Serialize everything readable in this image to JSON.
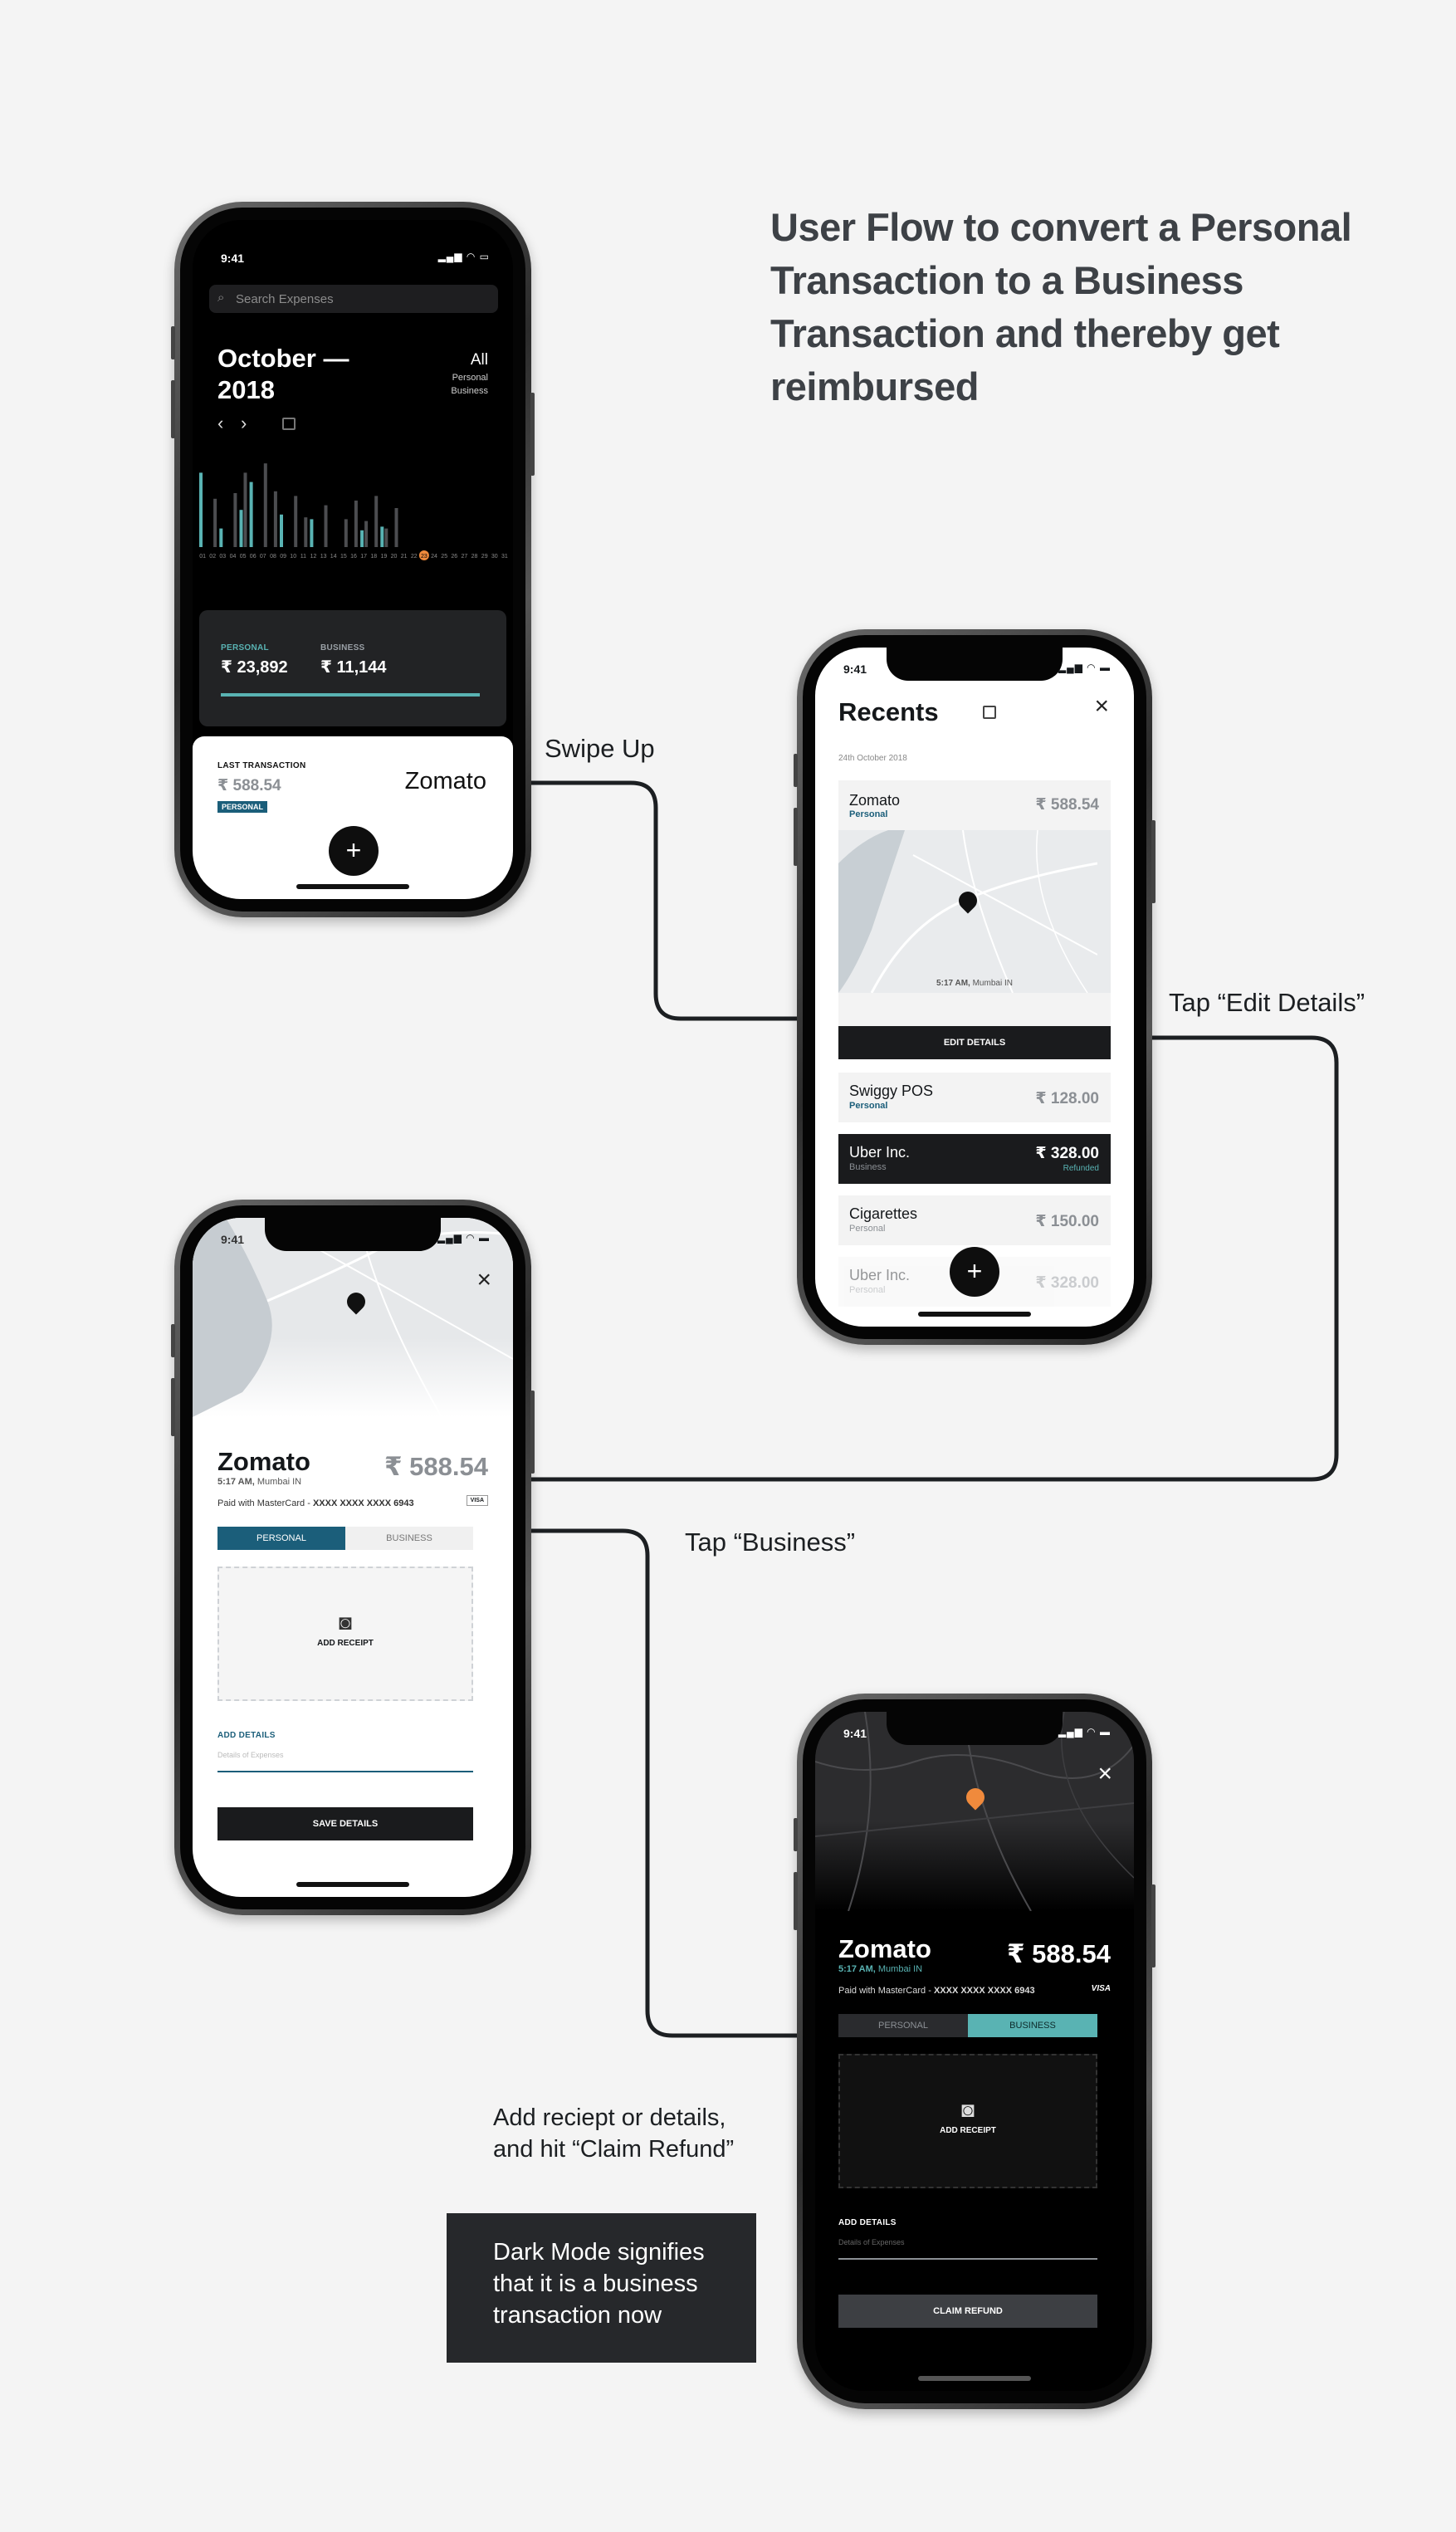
{
  "heading": "User Flow to convert a Personal Transaction to a Business Transaction and thereby get reimbursed",
  "flow_labels": {
    "swipe_up": "Swipe Up",
    "tap_edit": "Tap “Edit Details”",
    "tap_business": "Tap “Business”",
    "add_receipt_note": "Add reciept or details,\nand hit “Claim Refund”",
    "dark_mode_note": "Dark Mode signifies that it is a business transaction now"
  },
  "colors": {
    "teal": "#59b3b3",
    "navy": "#1b5e7a",
    "orange": "#f08a3c"
  },
  "status_bar": {
    "time": "9:41"
  },
  "screen1": {
    "search_placeholder": "Search Expenses",
    "month": "October",
    "year": "2018",
    "filter_all": "All",
    "filter_personal": "Personal",
    "filter_business": "Business",
    "chart_data": {
      "type": "bar",
      "categories": [
        "01",
        "02",
        "03",
        "04",
        "05",
        "06",
        "07",
        "08",
        "09",
        "10",
        "11",
        "12",
        "13",
        "14",
        "15",
        "16",
        "17",
        "18",
        "19",
        "20",
        "21",
        "22",
        "23",
        "24",
        "25",
        "26",
        "27",
        "28",
        "29",
        "30",
        "31"
      ],
      "series": [
        {
          "name": "Personal",
          "values": [
            80,
            0,
            20,
            0,
            40,
            70,
            0,
            0,
            35,
            0,
            0,
            30,
            0,
            0,
            0,
            0,
            18,
            0,
            22,
            0,
            0,
            0,
            0,
            0,
            0,
            0,
            0,
            0,
            0,
            0,
            0
          ]
        },
        {
          "name": "Business",
          "values": [
            0,
            52,
            0,
            58,
            80,
            0,
            90,
            60,
            0,
            55,
            32,
            0,
            45,
            0,
            30,
            50,
            28,
            55,
            20,
            42,
            0,
            0,
            0,
            0,
            0,
            0,
            0,
            0,
            0,
            0,
            0
          ]
        }
      ],
      "highlight": "23"
    },
    "personal_label": "PERSONAL",
    "personal_amount": "₹ 23,892",
    "business_label": "BUSINESS",
    "business_amount": "₹ 11,144",
    "last_label": "LAST TRANSACTION",
    "last_amount": "₹ 588.54",
    "last_tag": "PERSONAL",
    "last_merchant": "Zomato",
    "fab": "+"
  },
  "screen2": {
    "title": "Recents",
    "date": "24th October 2018",
    "featured": {
      "merchant": "Zomato",
      "type": "Personal",
      "amount": "₹ 588.54",
      "map_caption_time": "5:17 AM,",
      "map_caption_place": "Mumbai IN",
      "edit_button": "EDIT DETAILS"
    },
    "items": [
      {
        "merchant": "Swiggy POS",
        "type": "Personal",
        "amount": "₹ 128.00"
      },
      {
        "merchant": "Uber Inc.",
        "type": "Business",
        "amount": "₹ 328.00",
        "status": "Refunded"
      },
      {
        "merchant": "Cigarettes",
        "type": "Personal",
        "amount": "₹ 150.00"
      },
      {
        "merchant": "Uber Inc.",
        "type": "Personal",
        "amount": "₹ 328.00"
      }
    ],
    "fab": "+"
  },
  "screen3": {
    "merchant": "Zomato",
    "amount": "₹ 588.54",
    "time": "5:17 AM,",
    "place": "Mumbai IN",
    "paid_prefix": "Paid with MasterCard - ",
    "card_number": "XXXX XXXX XXXX 6943",
    "card_brand": "VISA",
    "tab_personal": "PERSONAL",
    "tab_business": "BUSINESS",
    "add_receipt": "ADD RECEIPT",
    "add_details": "ADD DETAILS",
    "details_placeholder": "Details of Expenses",
    "save_button": "SAVE DETAILS"
  },
  "screen4": {
    "merchant": "Zomato",
    "amount": "₹ 588.54",
    "time": "5:17 AM,",
    "place": "Mumbai IN",
    "paid_prefix": "Paid with MasterCard - ",
    "card_number": "XXXX XXXX XXXX 6943",
    "card_brand": "VISA",
    "tab_personal": "PERSONAL",
    "tab_business": "BUSINESS",
    "add_receipt": "ADD RECEIPT",
    "add_details": "ADD DETAILS",
    "details_placeholder": "Details of Expenses",
    "claim_button": "CLAIM REFUND"
  }
}
